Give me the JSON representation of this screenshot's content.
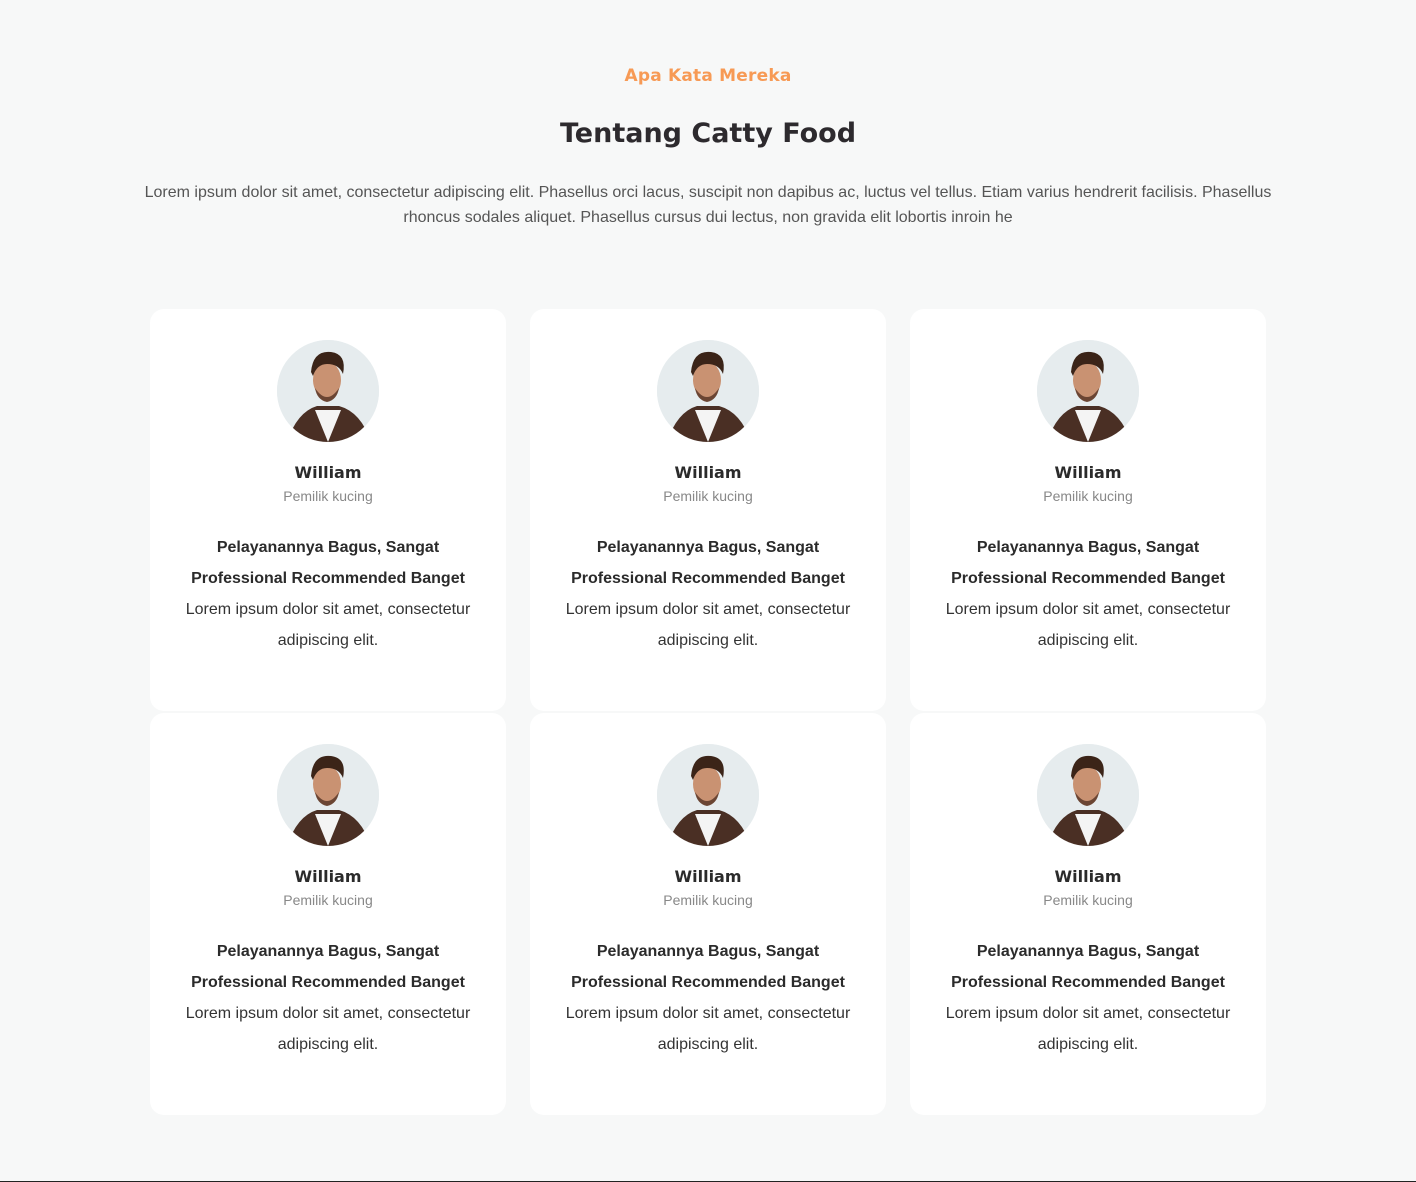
{
  "section": {
    "eyebrow": "Apa Kata Mereka",
    "title": "Tentang Catty Food",
    "intro": "Lorem ipsum dolor sit amet, consectetur adipiscing elit. Phasellus orci lacus, suscipit non dapibus ac, luctus vel tellus. Etiam varius hendrerit facilisis. Phasellus rhoncus sodales aliquet. Phasellus cursus dui lectus, non gravida elit lobortis inroin he"
  },
  "testimonials": [
    {
      "name": "William",
      "role": "Pemilik kucing",
      "quote": "Pelayanannya Bagus, Sangat Professional Recommended Banget",
      "text": "Lorem ipsum dolor sit amet, consectetur adipiscing elit."
    },
    {
      "name": "William",
      "role": "Pemilik kucing",
      "quote": "Pelayanannya Bagus, Sangat Professional Recommended Banget",
      "text": "Lorem ipsum dolor sit amet, consectetur adipiscing elit."
    },
    {
      "name": "William",
      "role": "Pemilik kucing",
      "quote": "Pelayanannya Bagus, Sangat Professional Recommended Banget",
      "text": "Lorem ipsum dolor sit amet, consectetur adipiscing elit."
    },
    {
      "name": "William",
      "role": "Pemilik kucing",
      "quote": "Pelayanannya Bagus, Sangat Professional Recommended Banget",
      "text": "Lorem ipsum dolor sit amet, consectetur adipiscing elit."
    },
    {
      "name": "William",
      "role": "Pemilik kucing",
      "quote": "Pelayanannya Bagus, Sangat Professional Recommended Banget",
      "text": "Lorem ipsum dolor sit amet, consectetur adipiscing elit."
    },
    {
      "name": "William",
      "role": "Pemilik kucing",
      "quote": "Pelayanannya Bagus, Sangat Professional Recommended Banget",
      "text": "Lorem ipsum dolor sit amet, consectetur adipiscing elit."
    }
  ],
  "colors": {
    "accent": "#f79a55",
    "heading": "#2d2a2e",
    "background": "#f7f8f8"
  }
}
